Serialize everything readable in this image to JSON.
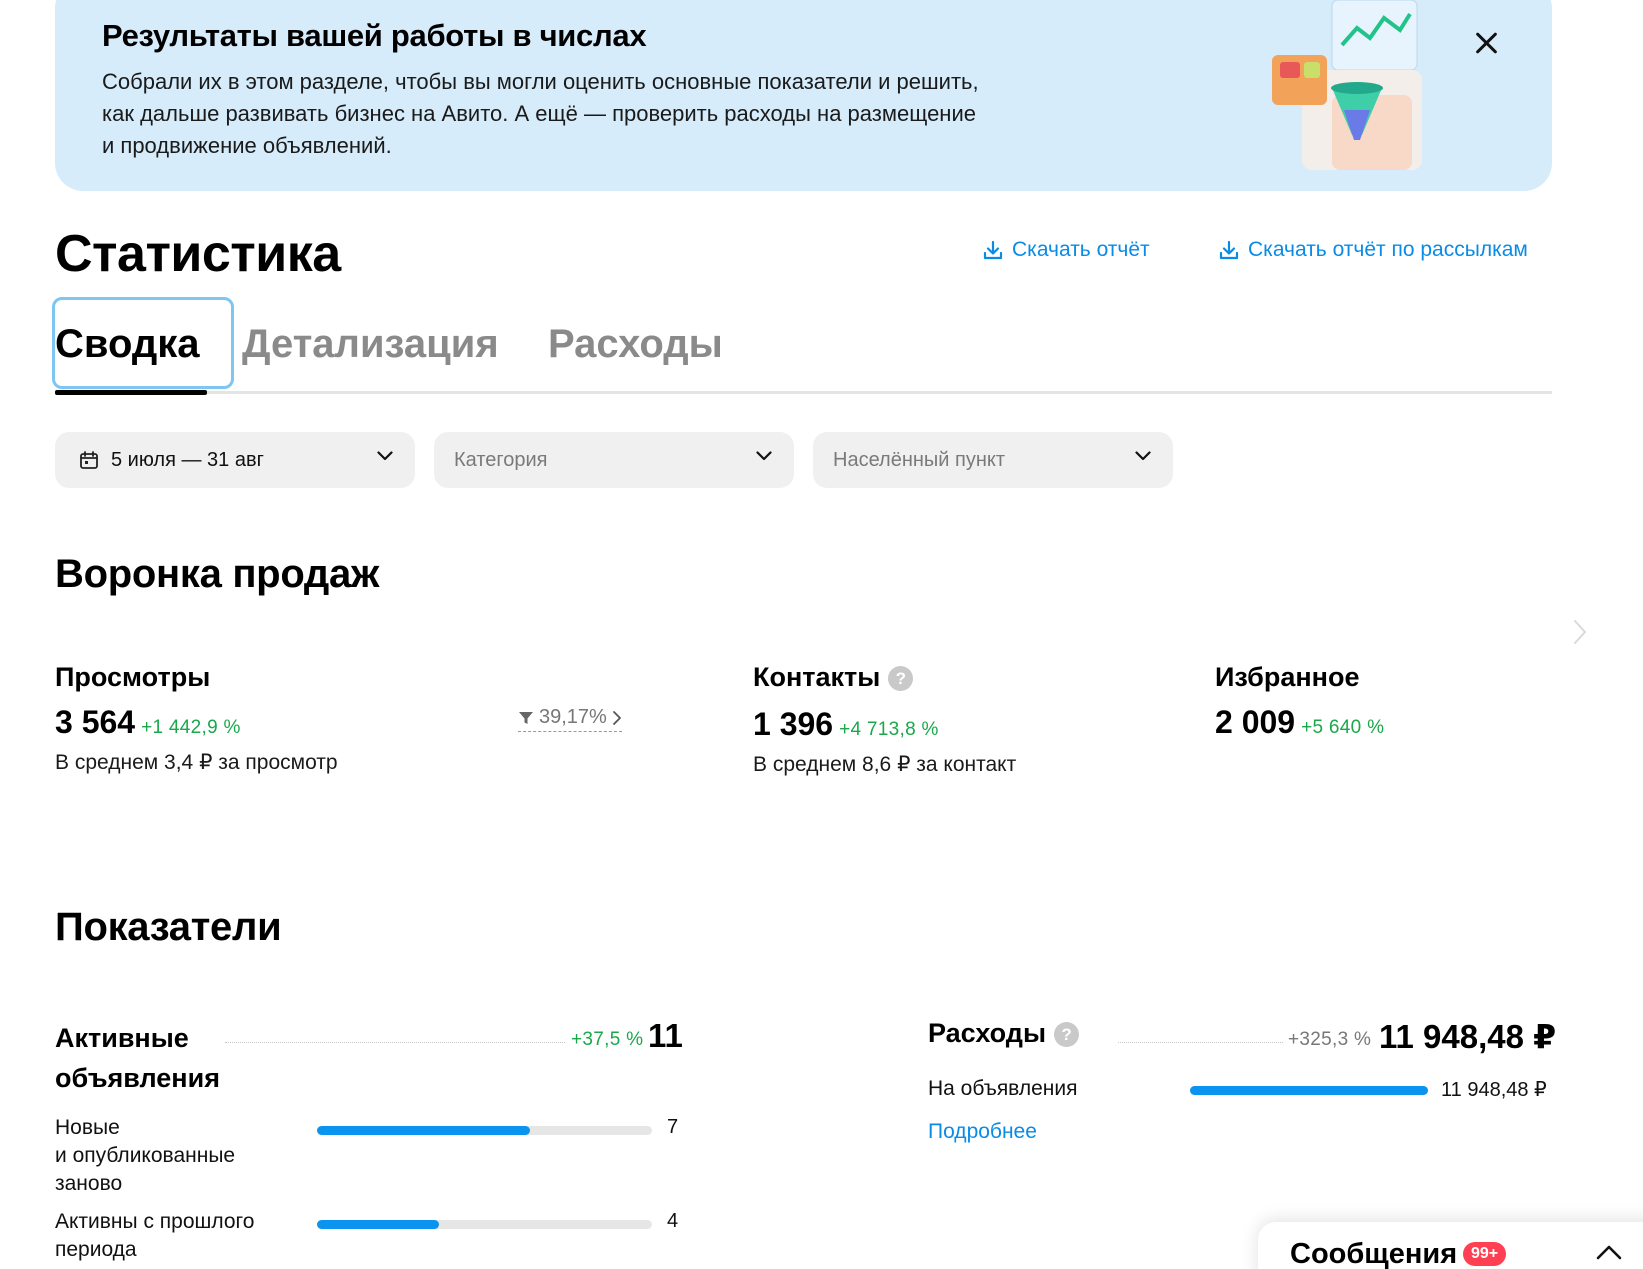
{
  "banner": {
    "title": "Результаты вашей работы в числах",
    "text_lines": [
      "Собрали их в этом разделе, чтобы вы могли оценить основные показатели и решить,",
      "как дальше развивать бизнес на Авито. А ещё — проверить расходы на размещение",
      "и продвижение объявлений."
    ],
    "close_icon": "close-icon",
    "background": "#d6ecfb"
  },
  "header": {
    "title": "Статистика",
    "download_report": "Скачать отчёт",
    "download_mailing_report": "Скачать отчёт по рассылкам",
    "link_color": "#0a8be6"
  },
  "tabs": [
    {
      "label": "Сводка",
      "active": true
    },
    {
      "label": "Детализация",
      "active": false
    },
    {
      "label": "Расходы",
      "active": false
    }
  ],
  "filters": {
    "period": "5 июля — 31 авг",
    "category_placeholder": "Категория",
    "city_placeholder": "Населённый пункт"
  },
  "funnel": {
    "title": "Воронка продаж",
    "views": {
      "name": "Просмотры",
      "value": "3 564",
      "delta": "+1 442,9 %",
      "sub": "В среднем 3,4 ₽ за просмотр",
      "conversion": "39,17%"
    },
    "contacts": {
      "name": "Контакты",
      "value": "1 396",
      "delta": "+4 713,8 %",
      "sub": "В среднем 8,6 ₽ за контакт"
    },
    "favorites": {
      "name": "Избранное",
      "value": "2 009",
      "delta": "+5 640 %"
    }
  },
  "metrics": {
    "title": "Показатели",
    "active_ads": {
      "name_line1": "Активные",
      "name_line2": "объявления",
      "delta": "+37,5 %",
      "value": "11",
      "rows": [
        {
          "label_lines": [
            "Новые",
            "и опубликованные",
            "заново"
          ],
          "value": "7",
          "fraction": 0.636
        },
        {
          "label_lines": [
            "Активны с прошлого",
            "периода"
          ],
          "value": "4",
          "fraction": 0.364
        }
      ]
    },
    "expenses": {
      "name": "Расходы",
      "delta": "+325,3 %",
      "value": "11 948,48 ₽",
      "rows": [
        {
          "label": "На объявления",
          "value": "11 948,48 ₽",
          "fraction": 1.0
        }
      ],
      "more_link": "Подробнее"
    }
  },
  "messages": {
    "title": "Сообщения",
    "badge": "99+"
  },
  "colors": {
    "accent_blue": "#0a94f0",
    "positive_green": "#1aa84a",
    "badge_red": "#ff4053"
  }
}
